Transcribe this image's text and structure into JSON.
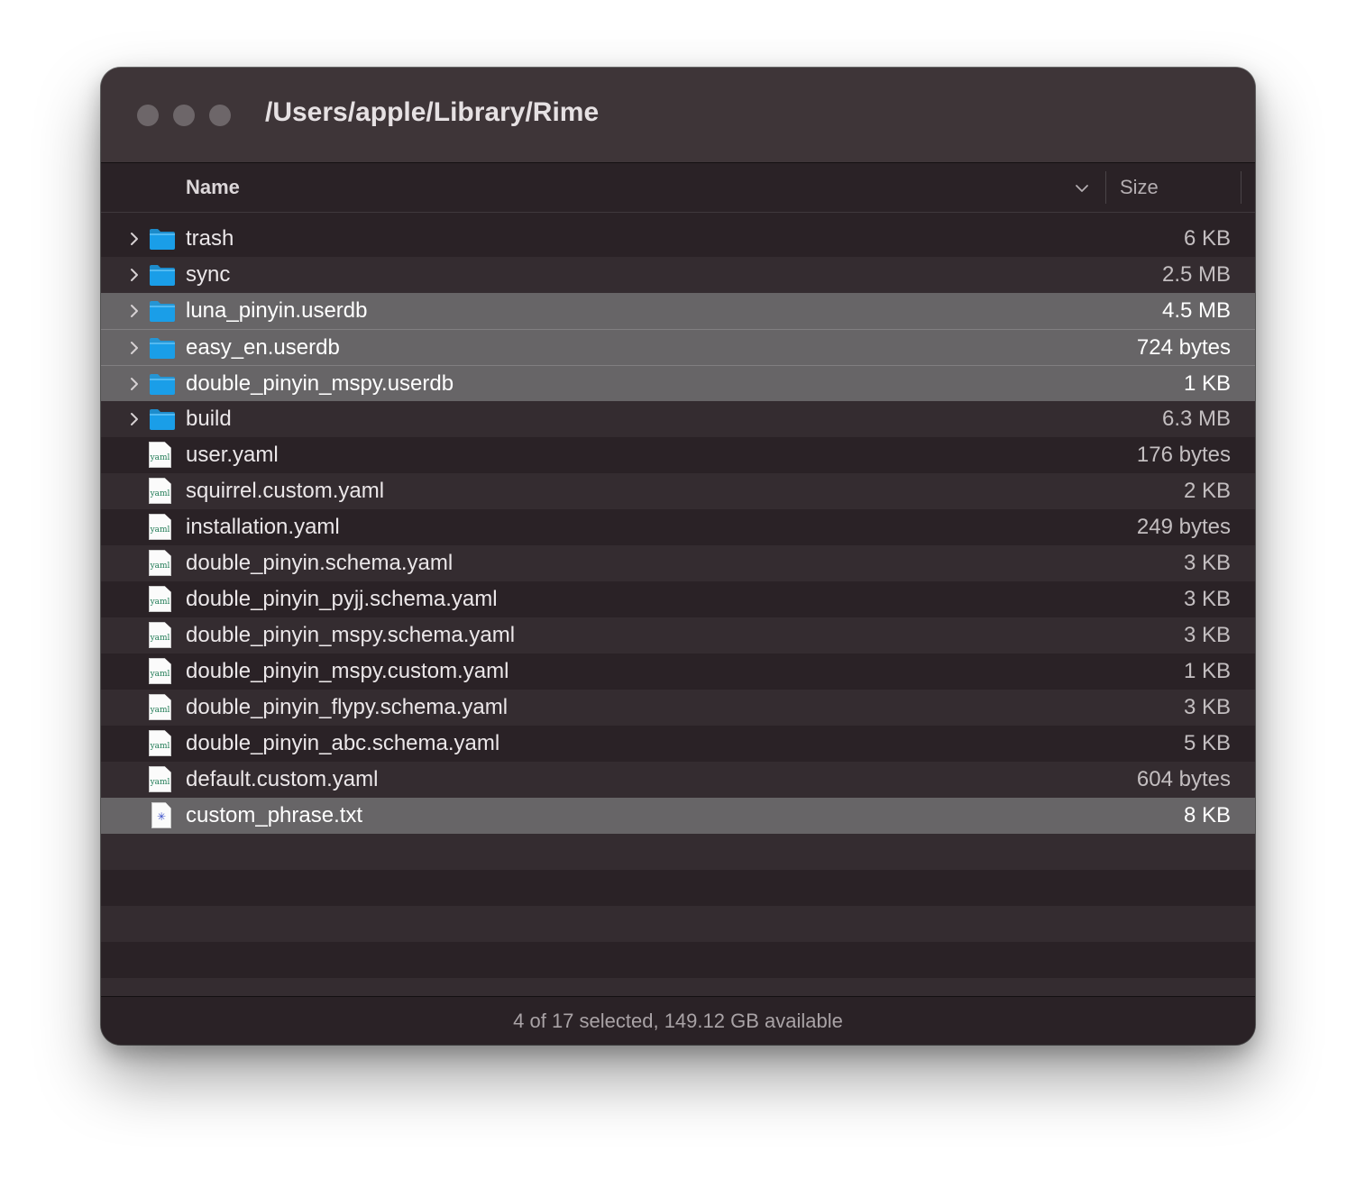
{
  "window": {
    "title": "/Users/apple/Library/Rime"
  },
  "columns": {
    "name": "Name",
    "size": "Size",
    "sort_icon": "chevron-down-icon"
  },
  "files": [
    {
      "name": "trash",
      "size": "6 KB",
      "kind": "folder",
      "selected": false
    },
    {
      "name": "sync",
      "size": "2.5 MB",
      "kind": "folder",
      "selected": false
    },
    {
      "name": "luna_pinyin.userdb",
      "size": "4.5 MB",
      "kind": "folder",
      "selected": true
    },
    {
      "name": "easy_en.userdb",
      "size": "724 bytes",
      "kind": "folder",
      "selected": true
    },
    {
      "name": "double_pinyin_mspy.userdb",
      "size": "1 KB",
      "kind": "folder",
      "selected": true
    },
    {
      "name": "build",
      "size": "6.3 MB",
      "kind": "folder",
      "selected": false
    },
    {
      "name": "user.yaml",
      "size": "176 bytes",
      "kind": "yaml",
      "selected": false
    },
    {
      "name": "squirrel.custom.yaml",
      "size": "2 KB",
      "kind": "yaml",
      "selected": false
    },
    {
      "name": "installation.yaml",
      "size": "249 bytes",
      "kind": "yaml",
      "selected": false
    },
    {
      "name": "double_pinyin.schema.yaml",
      "size": "3 KB",
      "kind": "yaml",
      "selected": false
    },
    {
      "name": "double_pinyin_pyjj.schema.yaml",
      "size": "3 KB",
      "kind": "yaml",
      "selected": false
    },
    {
      "name": "double_pinyin_mspy.schema.yaml",
      "size": "3 KB",
      "kind": "yaml",
      "selected": false
    },
    {
      "name": "double_pinyin_mspy.custom.yaml",
      "size": "1 KB",
      "kind": "yaml",
      "selected": false
    },
    {
      "name": "double_pinyin_flypy.schema.yaml",
      "size": "3 KB",
      "kind": "yaml",
      "selected": false
    },
    {
      "name": "double_pinyin_abc.schema.yaml",
      "size": "5 KB",
      "kind": "yaml",
      "selected": false
    },
    {
      "name": "default.custom.yaml",
      "size": "604 bytes",
      "kind": "yaml",
      "selected": false
    },
    {
      "name": "custom_phrase.txt",
      "size": "8 KB",
      "kind": "text",
      "selected": true
    }
  ],
  "icons": {
    "folder": "folder-icon",
    "yaml": "yaml-file-icon",
    "text": "text-file-icon",
    "disclosure": "chevron-right-icon",
    "yaml_label": "yaml"
  },
  "colors": {
    "folder": "#1a9ee8",
    "selection": "#676567",
    "window_bg": "#2a2226"
  },
  "status": {
    "text": "4 of 17 selected, 149.12 GB available"
  }
}
